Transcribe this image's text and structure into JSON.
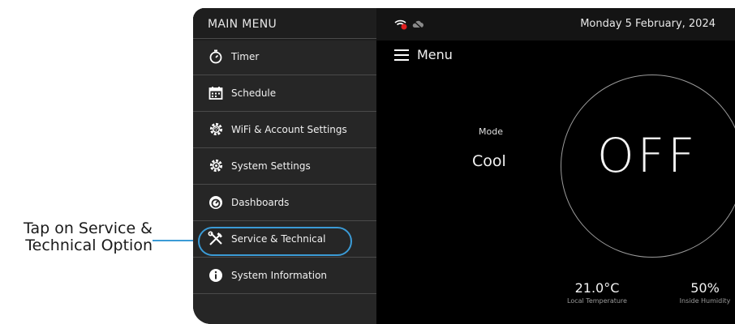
{
  "annotation": {
    "line1": "Tap on Service &",
    "line2": "Technical Option"
  },
  "sidebar": {
    "title": "MAIN MENU",
    "items": [
      {
        "label": "Timer",
        "icon": "timer-icon"
      },
      {
        "label": "Schedule",
        "icon": "calendar-icon"
      },
      {
        "label": "WiFi & Account Settings",
        "icon": "wifi-settings-icon"
      },
      {
        "label": "System Settings",
        "icon": "gear-icon"
      },
      {
        "label": "Dashboards",
        "icon": "dashboard-icon"
      },
      {
        "label": "Service & Technical",
        "icon": "tools-icon"
      },
      {
        "label": "System Information",
        "icon": "info-icon"
      }
    ],
    "highlighted_item": "Service & Technical"
  },
  "status_bar": {
    "date": "Monday 5 February, 2024",
    "icons": [
      "wifi-disconnected-icon",
      "cloud-offline-icon"
    ]
  },
  "header": {
    "menu_label": "Menu"
  },
  "main": {
    "mode_label": "Mode",
    "mode_value": "Cool",
    "power_state": "OFF",
    "temperature_value": "21.0°C",
    "temperature_label": "Local Temperature",
    "humidity_value": "50%",
    "humidity_label": "Inside Humidity"
  },
  "colors": {
    "accent": "#3b9bd6",
    "sidebar_bg": "#262626",
    "screen_bg": "#000000",
    "alert": "#e02020"
  }
}
